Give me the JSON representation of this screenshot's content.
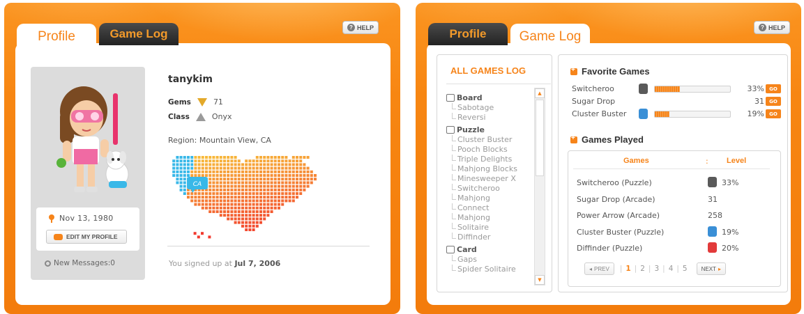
{
  "profile_window": {
    "tabs": [
      {
        "label": "Profile",
        "active": true
      },
      {
        "label": "Game Log",
        "active": false
      }
    ],
    "help_label": "HELP",
    "username": "tanykim",
    "gems_label": "Gems",
    "gems_value": "71",
    "class_label": "Class",
    "class_value": "Onyx",
    "region_text": "Region: Mountain View, CA",
    "map_marker_label": "CA",
    "birthday": "Nov 13, 1980",
    "edit_profile_label": "EDIT MY PROFILE",
    "new_messages": "New Messages:0",
    "signup_prefix": "You signed up at",
    "signup_date": "Jul 7, 2006"
  },
  "gamelog_window": {
    "tabs": [
      {
        "label": "Profile",
        "active": false
      },
      {
        "label": "Game Log",
        "active": true
      }
    ],
    "help_label": "HELP",
    "sidebar_title": "ALL GAMES LOG",
    "categories": [
      {
        "name": "Board",
        "games": [
          "Sabotage",
          "Reversi"
        ]
      },
      {
        "name": "Puzzle",
        "games": [
          "Cluster Buster",
          "Pooch Blocks",
          "Triple Delights",
          "Mahjong Blocks",
          "Minesweeper X",
          "Switcheroo",
          "Mahjong",
          "Connect",
          "Mahjong",
          "Solitaire",
          "Diffinder"
        ]
      },
      {
        "name": "Card",
        "games": [
          "Gaps",
          "Spider Solitaire"
        ]
      }
    ],
    "favorite_title": "Favorite Games",
    "favorites": [
      {
        "name": "Switcheroo",
        "value": "33%",
        "progress": 0.33,
        "icon": "switcheroo-icon",
        "go": "GO"
      },
      {
        "name": "Sugar Drop",
        "value": "31",
        "progress": null,
        "icon": "",
        "go": "GO"
      },
      {
        "name": "Cluster Buster",
        "value": "19%",
        "progress": 0.19,
        "icon": "cluster-buster-icon",
        "go": "GO"
      }
    ],
    "played_title": "Games Played",
    "played_headers": {
      "games": "Games",
      "separator": ":",
      "level": "Level"
    },
    "played": [
      {
        "game": "Switcheroo (Puzzle)",
        "level": "33%",
        "icon": "switcheroo-icon"
      },
      {
        "game": "Sugar Drop (Arcade)",
        "level": "31",
        "icon": ""
      },
      {
        "game": "Power Arrow (Arcade)",
        "level": "258",
        "icon": ""
      },
      {
        "game": "Cluster Buster (Puzzle)",
        "level": "19%",
        "icon": "cluster-buster-icon"
      },
      {
        "game": "Diffinder (Puzzle)",
        "level": "20%",
        "icon": "diffinder-icon"
      }
    ],
    "pager": {
      "prev": "PREV",
      "pages": [
        "1",
        "2",
        "3",
        "4",
        "5"
      ],
      "current": "1",
      "next": "NEXT"
    }
  },
  "colors": {
    "accent": "#f6841a",
    "frame": "#f78612",
    "tab_dark": "#2b2b2b",
    "map_warm_top": "#f8c23c",
    "map_warm_bottom": "#f23a2e",
    "map_ca": "#39b8e8"
  }
}
